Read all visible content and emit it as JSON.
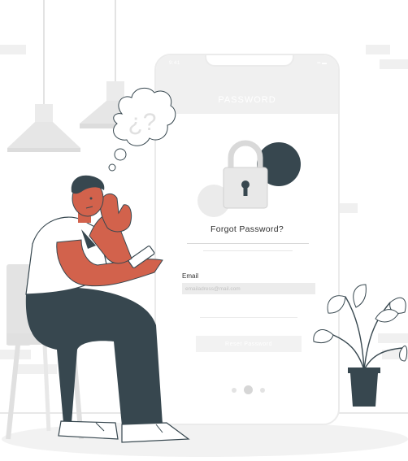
{
  "phone": {
    "status_time": "9:41",
    "status_right": "▪▪ ▬",
    "back_icon": "‹",
    "title": "PASSWORD",
    "heading": "Forgot Password?",
    "email_label": "Email",
    "email_placeholder": "emailadress@mail.com",
    "button_label": "Reset Password",
    "pagination": {
      "count": 3,
      "active_index": 1
    }
  },
  "illustration": {
    "thought_bubble_text": "¿?",
    "icons": [
      "lock-icon",
      "thought-bubble-icon",
      "pendant-lamp-icon",
      "plant-icon",
      "chair-icon"
    ]
  },
  "colors": {
    "accent": "#d2624c",
    "dark": "#37474f",
    "light_gray": "#ebebeb",
    "mid_gray": "#d6d6d6"
  }
}
